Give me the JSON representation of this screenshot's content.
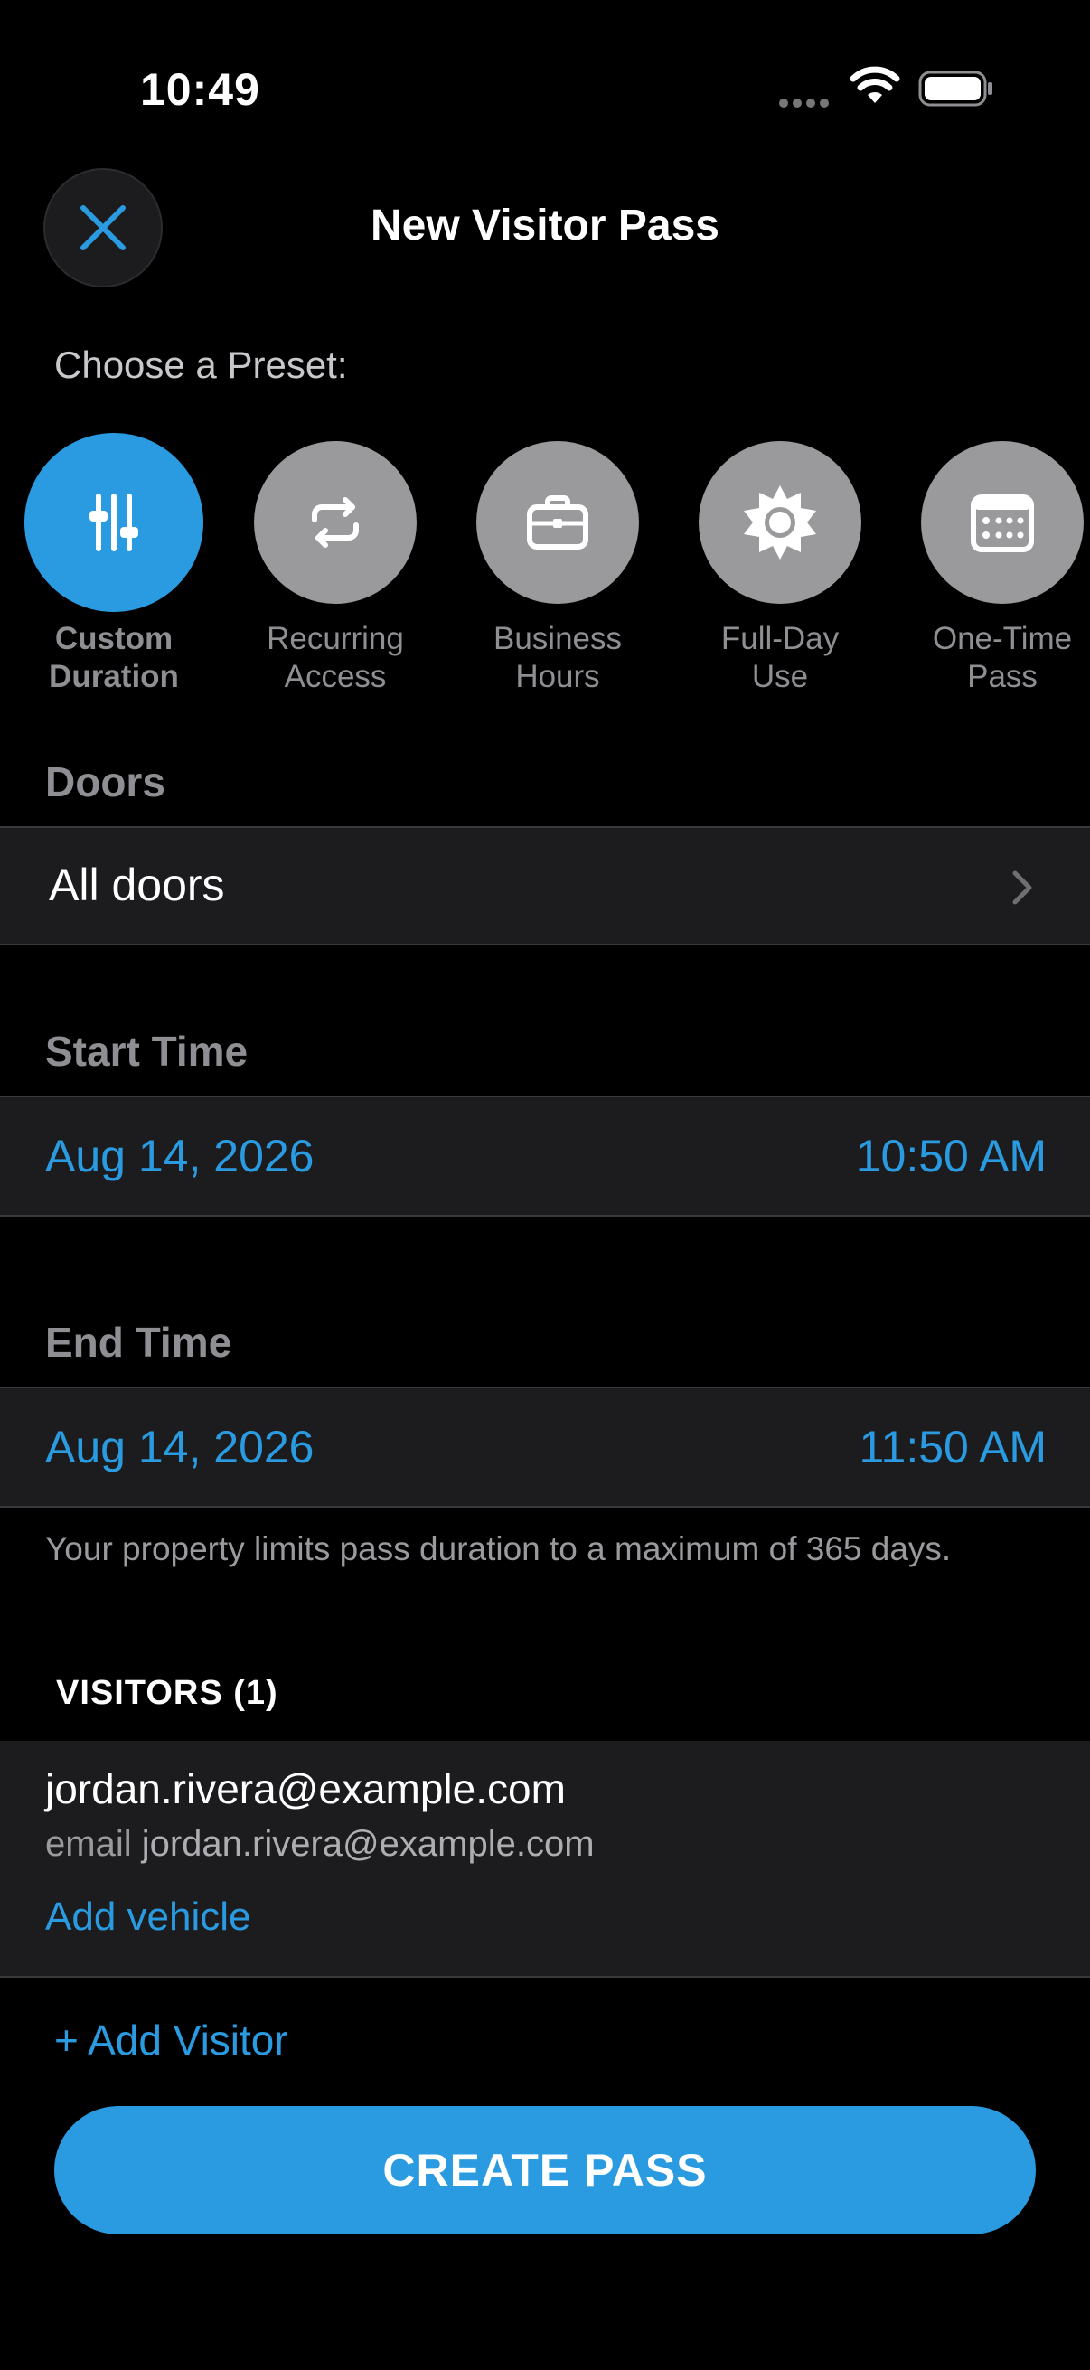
{
  "status_bar": {
    "time": "10:49",
    "wifi_icon": "wifi-icon",
    "battery_icon": "battery-icon"
  },
  "header": {
    "title": "New Visitor Pass",
    "close_icon": "close-icon"
  },
  "preset_label": "Choose a Preset:",
  "presets": [
    {
      "line1": "Custom",
      "line2": "Duration",
      "icon": "sliders-icon",
      "selected": true
    },
    {
      "line1": "Recurring",
      "line2": "Access",
      "icon": "repeat-icon",
      "selected": false
    },
    {
      "line1": "Business",
      "line2": "Hours",
      "icon": "briefcase-icon",
      "selected": false
    },
    {
      "line1": "Full-Day",
      "line2": "Use",
      "icon": "sun-icon",
      "selected": false
    },
    {
      "line1": "One-Time",
      "line2": "Pass",
      "icon": "calendar-icon",
      "selected": false
    }
  ],
  "doors": {
    "heading": "Doors",
    "value": "All doors"
  },
  "start_time": {
    "heading": "Start Time",
    "date": "Aug 14, 2026",
    "time": "10:50 AM"
  },
  "end_time": {
    "heading": "End Time",
    "date": "Aug 14, 2026",
    "time": "11:50 AM"
  },
  "duration_note": "Your property limits pass duration to a maximum of 365 days.",
  "visitors": {
    "heading": "VISITORS (1)",
    "items": [
      {
        "email": "jordan.rivera@example.com",
        "sub_label": "email",
        "sub_value": "jordan.rivera@example.com",
        "add_vehicle": "Add vehicle"
      }
    ]
  },
  "add_visitor": "+ Add Visitor",
  "create_button": "CREATE PASS",
  "colors": {
    "accent": "#2a9be0",
    "background": "#000000",
    "row": "#1c1c1e",
    "muted": "#8e8e93"
  }
}
